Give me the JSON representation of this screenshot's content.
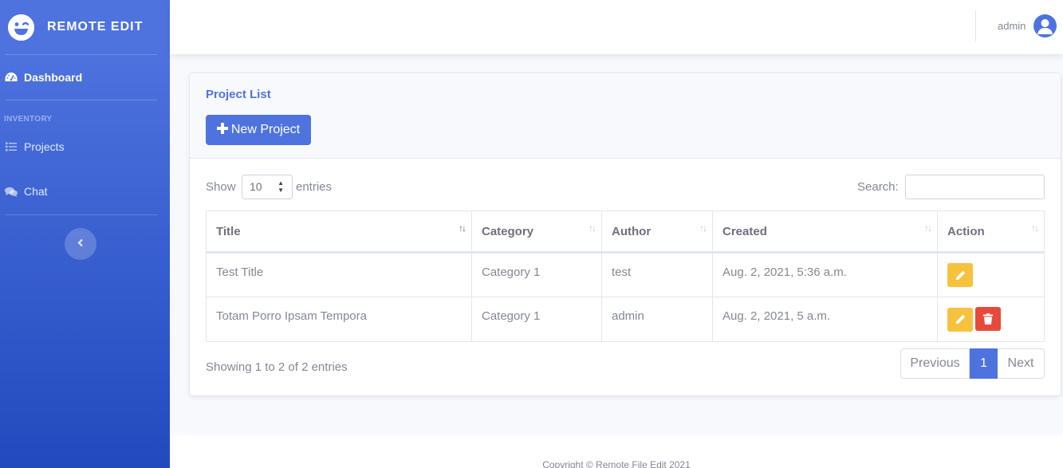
{
  "sidebar": {
    "brand": "REMOTE EDIT",
    "items": [
      {
        "label": "Dashboard",
        "icon": "tachometer-icon"
      },
      {
        "heading": "INVENTORY"
      },
      {
        "label": "Projects",
        "icon": "list-icon"
      },
      {
        "label": "Chat",
        "icon": "comments-icon"
      }
    ]
  },
  "topbar": {
    "user": "admin"
  },
  "card": {
    "title": "Project List",
    "new_button": "New Project",
    "show_label": "Show",
    "entries_value": "10",
    "entries_label": "entries",
    "search_label": "Search:",
    "search_value": "",
    "columns": [
      "Title",
      "Category",
      "Author",
      "Created",
      "Action"
    ],
    "rows": [
      {
        "title": "Test Title",
        "category": "Category 1",
        "author": "test",
        "created": "Aug. 2, 2021, 5:36 a.m."
      },
      {
        "title": "Totam Porro Ipsam Tempora",
        "category": "Category 1",
        "author": "admin",
        "created": "Aug. 2, 2021, 5 a.m."
      }
    ],
    "info": "Showing 1 to 2 of 2 entries",
    "pagination": {
      "previous": "Previous",
      "current": "1",
      "next": "Next"
    }
  },
  "footer": {
    "text": "Copyright © Remote File Edit 2021"
  },
  "colors": {
    "primary": "#4e73df",
    "warning": "#f6c23e",
    "danger": "#e74a3b"
  }
}
